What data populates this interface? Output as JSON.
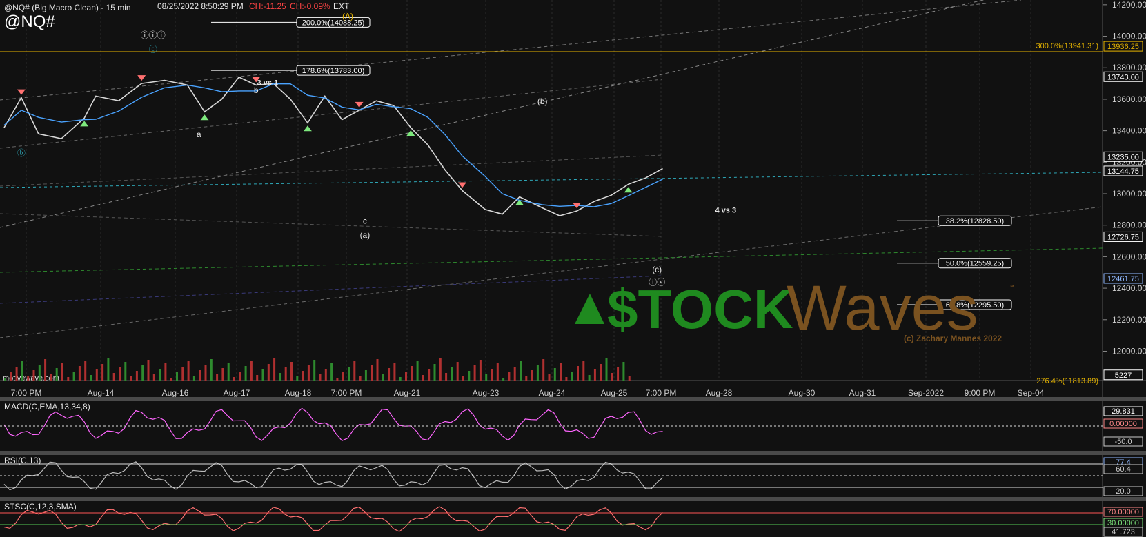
{
  "header": {
    "symbol_title": "@NQ# (Big Macro Clean) - 15 min",
    "datetime": "08/25/2022 8:50:29 PM",
    "change_points": "CH:-11.25",
    "change_percent": "CH:-0.09%",
    "session": "EXT",
    "symbol": "@NQ#",
    "watermark_site": "motivewave.com"
  },
  "colors": {
    "background": "#111111",
    "price_line": "#d8d8d8",
    "moving_average": "#4aa3ff",
    "fib_line": "#ffffff",
    "resistance_line": "#e6b400",
    "cyan_dashed": "#2ea8b8",
    "green_dashed": "#2e8b2e",
    "buy_marker": "#7de87d",
    "sell_marker": "#ff7070",
    "macd_line": "#ff66ff",
    "macd_hist": "#6ab8e8",
    "logo_green": "#1f8a1f",
    "logo_brown": "#7a5220"
  },
  "chart_data": {
    "type": "line",
    "title": "@NQ# (Big Macro Clean) - 15 min",
    "timeframe": "15 min",
    "x_ticks": [
      "7:00 PM",
      "Aug-14",
      "Aug-16",
      "Aug-17",
      "Aug-18",
      "7:00 PM",
      "Aug-21",
      "Aug-23",
      "Aug-24",
      "Aug-25",
      "7:00 PM",
      "Aug-28",
      "Aug-30",
      "Aug-31",
      "Sep-2022",
      "9:00 PM",
      "Sep-04"
    ],
    "ylim": [
      11813.89,
      14230
    ],
    "y_ticks": [
      14200,
      14000,
      13800,
      13600,
      13400,
      13200,
      13000,
      12800,
      12600,
      12400,
      12200,
      12000
    ],
    "y_tick_labels": [
      "14200.00",
      "14000.00",
      "13800.00",
      "13600.00",
      "13400.00",
      "13200.00",
      "13000.00",
      "12800.00",
      "12600.00",
      "12400.00",
      "12200.00",
      "12000.00"
    ],
    "price_path": [
      [
        0,
        13420
      ],
      [
        3,
        13610
      ],
      [
        6,
        13380
      ],
      [
        10,
        13350
      ],
      [
        14,
        13480
      ],
      [
        16,
        13620
      ],
      [
        20,
        13590
      ],
      [
        24,
        13700
      ],
      [
        28,
        13720
      ],
      [
        32,
        13690
      ],
      [
        35,
        13520
      ],
      [
        38,
        13600
      ],
      [
        41,
        13740
      ],
      [
        44,
        13690
      ],
      [
        47,
        13700
      ],
      [
        50,
        13600
      ],
      [
        53,
        13450
      ],
      [
        56,
        13620
      ],
      [
        59,
        13470
      ],
      [
        62,
        13530
      ],
      [
        65,
        13590
      ],
      [
        68,
        13560
      ],
      [
        71,
        13420
      ],
      [
        74,
        13310
      ],
      [
        77,
        13150
      ],
      [
        80,
        13020
      ],
      [
        84,
        12900
      ],
      [
        87,
        12870
      ],
      [
        90,
        12980
      ],
      [
        94,
        12910
      ],
      [
        97,
        12860
      ],
      [
        100,
        12890
      ],
      [
        103,
        12950
      ],
      [
        106,
        12990
      ],
      [
        109,
        13060
      ],
      [
        112,
        13100
      ],
      [
        115,
        13160
      ]
    ],
    "last_price": "13144.75",
    "right_axis_badges": [
      {
        "label": "13936.25",
        "value": 13936.25,
        "color": "#e6b400"
      },
      {
        "label": "13743.00",
        "value": 13743,
        "color": "#ffffff"
      },
      {
        "label": "13235.00",
        "value": 13235,
        "color": "#ffffff"
      },
      {
        "label": "13144.75",
        "value": 13144.75,
        "color": "#ffffff"
      },
      {
        "label": "12726.75",
        "value": 12726.75,
        "color": "#ffffff"
      },
      {
        "label": "12461.75",
        "value": 12461.75,
        "color": "#8fb8ff"
      },
      {
        "label": "5227",
        "value": 11850,
        "color": "#ffffff"
      }
    ],
    "fib_levels": [
      {
        "label": "200.0%(14088.25)",
        "value": 14088.25
      },
      {
        "label": "178.6%(13783.00)",
        "value": 13783
      },
      {
        "label": "38.2%(12828.50)",
        "value": 12828.5
      },
      {
        "label": "50.0%(12559.25)",
        "value": 12559.25
      },
      {
        "label": "61.8%(12295.50)",
        "value": 12295.5
      }
    ],
    "extension_labels": [
      {
        "label": "300.0%(13941.31)",
        "value": 13941.31
      },
      {
        "label": "276.4%(11813.89)",
        "value": 11813.89
      }
    ],
    "wave_labels": [
      {
        "text": "(A)",
        "x": 60,
        "value": 14110
      },
      {
        "text": "ⓘⓘⓘ",
        "x": 26,
        "value": 13990
      },
      {
        "text": "ⓒ",
        "x": 26,
        "value": 13900
      },
      {
        "text": "3 vs 1",
        "x": 46,
        "value": 13690
      },
      {
        "text": "b",
        "x": 44,
        "value": 13640
      },
      {
        "text": "a",
        "x": 34,
        "value": 13360
      },
      {
        "text": "(b)",
        "x": 94,
        "value": 13570
      },
      {
        "text": "c",
        "x": 63,
        "value": 12810
      },
      {
        "text": "(a)",
        "x": 63,
        "value": 12720
      },
      {
        "text": "4 vs 3",
        "x": 126,
        "value": 12880
      },
      {
        "text": "(c)",
        "x": 114,
        "value": 12500
      },
      {
        "text": "ⓘⓥ",
        "x": 114,
        "value": 12420
      },
      {
        "text": "ⓑ",
        "x": 3,
        "value": 13240
      }
    ],
    "indicators": {
      "macd": {
        "label": "MACD(C,EMA,13,34,8)",
        "value_label": "29.831",
        "zero_label": "0.00000",
        "low_label": "-50.0"
      },
      "rsi": {
        "label": "RSI(C,13)",
        "value_label": "77.4",
        "mid_label": "60.4",
        "low_label": "20.0"
      },
      "stoch": {
        "label": "STSC(C,12,3,SMA)",
        "upper_label": "70.00000",
        "lower_label": "30.00000",
        "value_label": "41.723"
      }
    }
  },
  "logo": {
    "part1": "$TOCK",
    "part2": "Waves",
    "trademark": "™",
    "copyright": "(c) Zachary Mannes 2022"
  }
}
